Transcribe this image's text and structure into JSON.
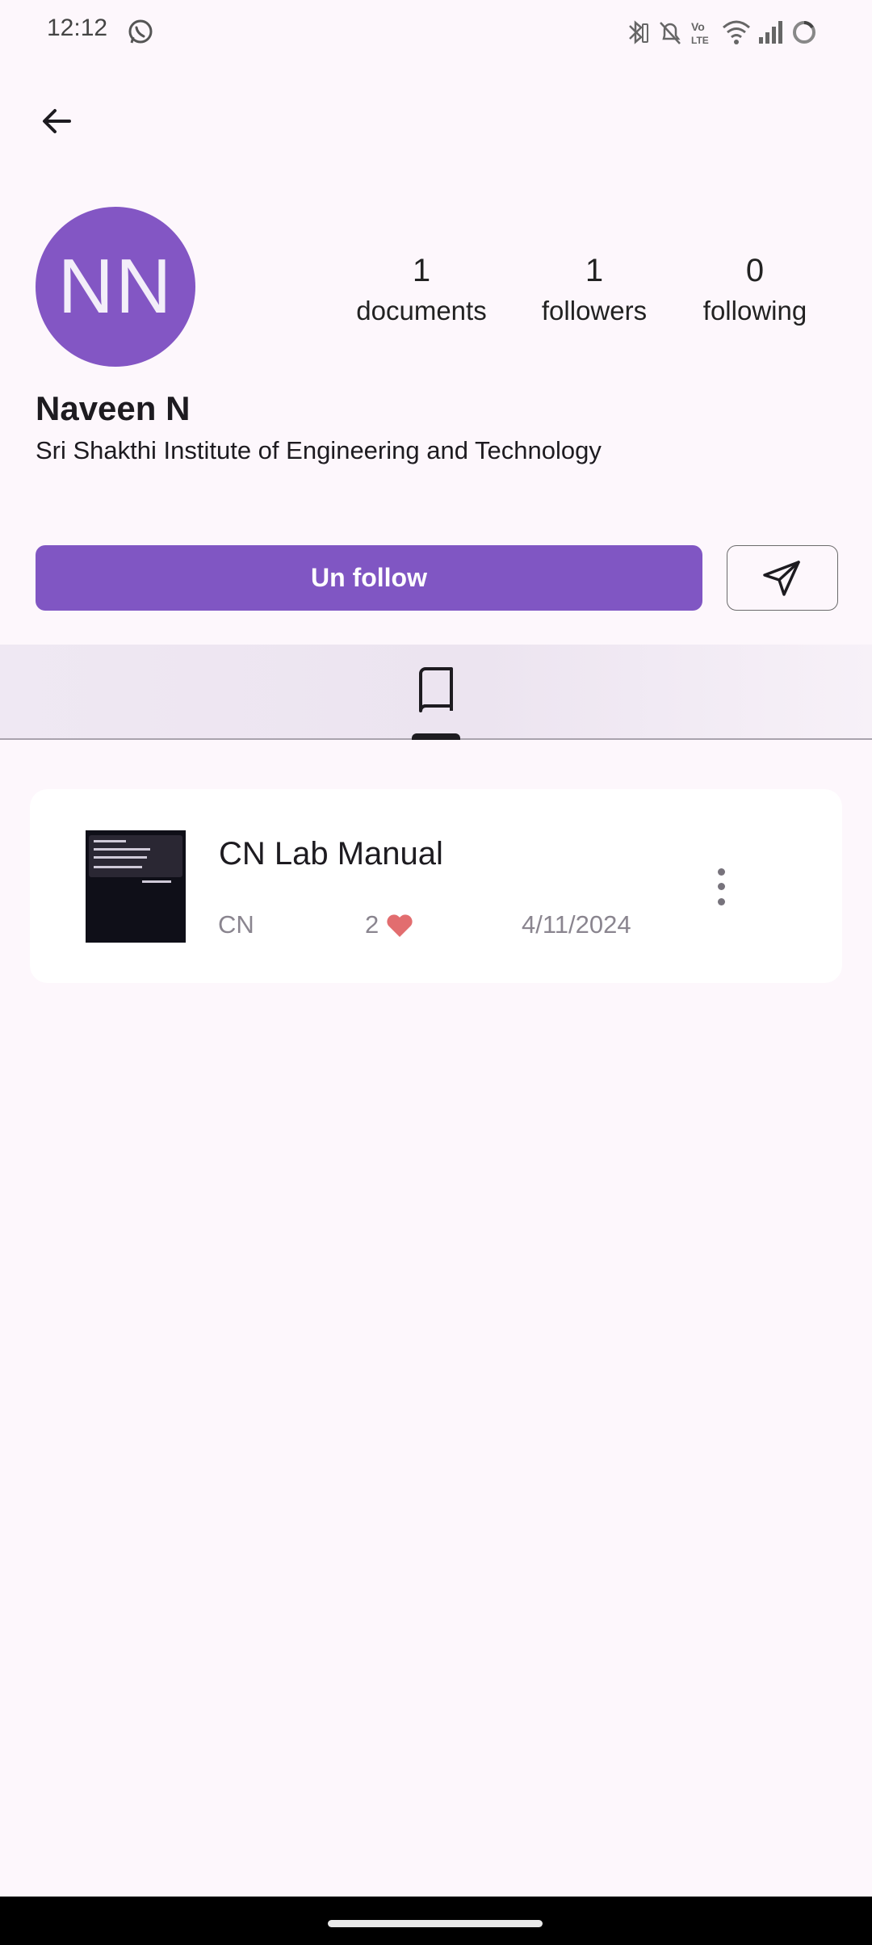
{
  "status_bar": {
    "time": "12:12",
    "icons": [
      "whatsapp-icon",
      "bluetooth-icon",
      "mute-icon",
      "volte-icon",
      "wifi-icon",
      "signal-icon",
      "battery-icon"
    ]
  },
  "profile": {
    "initials": "NN",
    "name": "Naveen N",
    "institution": "Sri Shakthi Institute of Engineering and Technology",
    "avatar_color": "#8356c4",
    "stats": {
      "documents": {
        "value": "1",
        "label": "documents"
      },
      "followers": {
        "value": "1",
        "label": "followers"
      },
      "following": {
        "value": "0",
        "label": "following"
      }
    }
  },
  "actions": {
    "unfollow_label": "Un follow",
    "accent": "#8056c3"
  },
  "tabs": [
    {
      "icon": "book-icon",
      "selected": true
    }
  ],
  "documents": [
    {
      "title": "CN Lab Manual",
      "category": "CN",
      "likes": "2",
      "date": "4/11/2024",
      "heart_color": "#e26d6f"
    }
  ]
}
